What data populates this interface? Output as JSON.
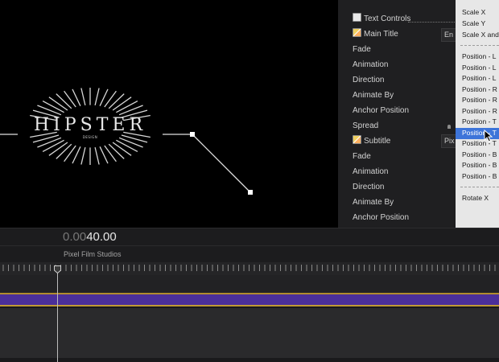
{
  "viewer": {
    "logo_title": "HIPSTER",
    "logo_subtitle": "DESIGN"
  },
  "inspector": {
    "rows": [
      {
        "label": "Text Controls",
        "checkbox": "cb"
      },
      {
        "label": "Main Title",
        "checkbox": "pen"
      },
      {
        "label": "Fade"
      },
      {
        "label": "Animation"
      },
      {
        "label": "Direction"
      },
      {
        "label": "Animate By"
      },
      {
        "label": "Anchor Position"
      },
      {
        "label": "Spread"
      },
      {
        "label": "Subtitle",
        "checkbox": "pen"
      },
      {
        "label": "Fade"
      },
      {
        "label": "Animation"
      },
      {
        "label": "Direction"
      },
      {
        "label": "Animate By"
      },
      {
        "label": "Anchor Position"
      }
    ],
    "main_title_popup": "En",
    "subtitle_popup": "Pix"
  },
  "menu": {
    "items": [
      {
        "label": "Scale X"
      },
      {
        "label": "Scale Y"
      },
      {
        "label": "Scale X and"
      },
      {
        "label": "Position - L"
      },
      {
        "label": "Position - L"
      },
      {
        "label": "Position - L"
      },
      {
        "label": "Position - R"
      },
      {
        "label": "Position - R"
      },
      {
        "label": "Position - R"
      },
      {
        "label": "Position - T"
      },
      {
        "label": "Position - T",
        "selected": true
      },
      {
        "label": "Position - T"
      },
      {
        "label": "Position - B"
      },
      {
        "label": "Position - B"
      },
      {
        "label": "Position - B"
      },
      {
        "label": "Rotate X"
      }
    ]
  },
  "timeline": {
    "timecode_dim": "0.00",
    "timecode_main": "40.00",
    "clip_name": "Pixel Film Studios"
  },
  "colors": {
    "selection": "#3d74d9",
    "track": "#4b2f9a",
    "track_border": "#c09a35"
  }
}
